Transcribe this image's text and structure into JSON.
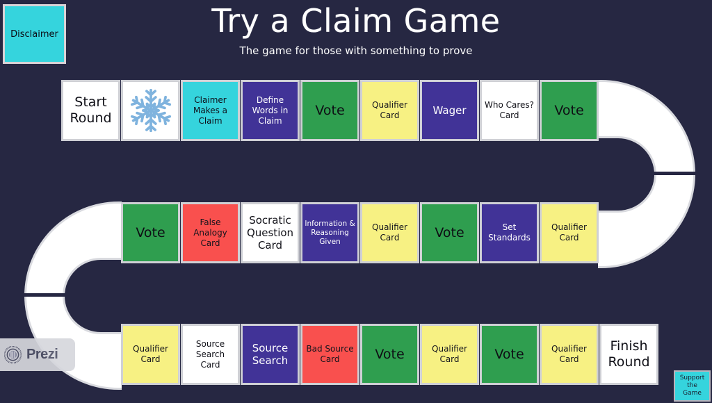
{
  "header": {
    "title": "Try a Claim Game",
    "subtitle": "The game for those with something to prove"
  },
  "disclaimer_button": {
    "label": "Disclaimer"
  },
  "support_button": {
    "line1": "Support",
    "line2": "the",
    "line3": "Game"
  },
  "prezi_badge": {
    "label": "Prezi"
  },
  "colors": {
    "background": "#262742",
    "white_card": "#ffffff",
    "green_card": "#2f9e4f",
    "yellow_card": "#f7f183",
    "purple_card": "#413397",
    "red_card": "#f9504e",
    "cyan_card": "#35d4dd",
    "card_border": "#cfd0d5",
    "track": "#ffffff",
    "snowflake": "#7fb3de"
  },
  "board": {
    "rows": [
      {
        "name": "row-1",
        "direction": "left-to-right",
        "cards": [
          {
            "label": "Start Round",
            "color": "white",
            "size": "big",
            "icon": null
          },
          {
            "label": "",
            "color": "white",
            "size": "big",
            "icon": "snowflake-icon"
          },
          {
            "label": "Claimer Makes a Claim",
            "color": "cyan",
            "size": "sm",
            "icon": null
          },
          {
            "label": "Define Words in Claim",
            "color": "purple",
            "size": "sm",
            "icon": null
          },
          {
            "label": "Vote",
            "color": "green",
            "size": "big",
            "icon": null
          },
          {
            "label": "Qualifier Card",
            "color": "yellow",
            "size": "sm",
            "icon": null
          },
          {
            "label": "Wager",
            "color": "purple",
            "size": "mid",
            "icon": null
          },
          {
            "label": "Who Cares? Card",
            "color": "white",
            "size": "sm",
            "icon": null
          },
          {
            "label": "Vote",
            "color": "green",
            "size": "big",
            "icon": null
          }
        ]
      },
      {
        "name": "row-2",
        "direction": "right-to-left",
        "cards": [
          {
            "label": "Vote",
            "color": "green",
            "size": "big",
            "icon": null
          },
          {
            "label": "False Analogy Card",
            "color": "red",
            "size": "sm",
            "icon": null
          },
          {
            "label": "Socratic Question Card",
            "color": "white",
            "size": "mid",
            "icon": null
          },
          {
            "label": "Information & Reasoning Given",
            "color": "purple",
            "size": "xs",
            "icon": null
          },
          {
            "label": "Qualifier Card",
            "color": "yellow",
            "size": "sm",
            "icon": null
          },
          {
            "label": "Vote",
            "color": "green",
            "size": "big",
            "icon": null
          },
          {
            "label": "Set Standards",
            "color": "purple",
            "size": "sm",
            "icon": null
          },
          {
            "label": "Qualifier Card",
            "color": "yellow",
            "size": "sm",
            "icon": null
          }
        ]
      },
      {
        "name": "row-3",
        "direction": "left-to-right",
        "cards": [
          {
            "label": "Qualifier Card",
            "color": "yellow",
            "size": "sm",
            "icon": null
          },
          {
            "label": "Source Search Card",
            "color": "white",
            "size": "sm",
            "icon": null
          },
          {
            "label": "Source Search",
            "color": "purple",
            "size": "mid",
            "icon": null
          },
          {
            "label": "Bad Source Card",
            "color": "red",
            "size": "sm",
            "icon": null
          },
          {
            "label": "Vote",
            "color": "green",
            "size": "big",
            "icon": null
          },
          {
            "label": "Qualifier Card",
            "color": "yellow",
            "size": "sm",
            "icon": null
          },
          {
            "label": "Vote",
            "color": "green",
            "size": "big",
            "icon": null
          },
          {
            "label": "Qualifier Card",
            "color": "yellow",
            "size": "sm",
            "icon": null
          },
          {
            "label": "Finish Round",
            "color": "white",
            "size": "big",
            "icon": null
          }
        ]
      }
    ]
  }
}
